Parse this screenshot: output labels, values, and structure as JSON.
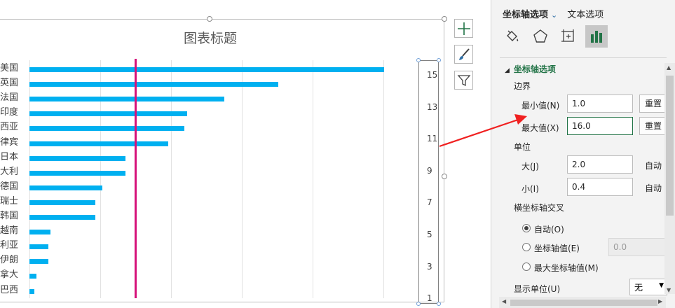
{
  "chart": {
    "title": "图表标题",
    "categories": [
      "美国",
      "英国",
      "法国",
      "印度",
      "西亚",
      "律宾",
      "日本",
      "大利",
      "德国",
      "瑞士",
      "韩国",
      "越南",
      "利亚",
      "伊朗",
      "拿大",
      "巴西"
    ],
    "values": [
      15.1,
      10.6,
      8.3,
      6.7,
      6.6,
      5.9,
      4.1,
      4.1,
      3.1,
      2.8,
      2.8,
      0.9,
      0.8,
      0.8,
      0.3,
      0.2
    ],
    "xmax": 16,
    "bar_color": "#00b0f0",
    "marker_color": "#d6127a",
    "secondary_ticks": [
      "15",
      "13",
      "11",
      "9",
      "7",
      "5",
      "3",
      "1"
    ]
  },
  "chart_data": {
    "type": "bar",
    "title": "图表标题",
    "categories": [
      "美国",
      "英国",
      "法国",
      "印度",
      "西亚",
      "律宾",
      "日本",
      "大利",
      "德国",
      "瑞士",
      "韩国",
      "越南",
      "利亚",
      "伊朗",
      "拿大",
      "巴西"
    ],
    "values": [
      15.1,
      10.6,
      8.3,
      6.7,
      6.6,
      5.9,
      4.1,
      4.1,
      3.1,
      2.8,
      2.8,
      0.9,
      0.8,
      0.8,
      0.3,
      0.2
    ],
    "secondary_axis_ticks": [
      15,
      13,
      11,
      9,
      7,
      5,
      3,
      1
    ],
    "secondary_axis_range": [
      1,
      16
    ],
    "grid": true
  },
  "panel": {
    "tab_axis": "坐标轴选项",
    "tab_text": "文本选项",
    "section": "坐标轴选项",
    "bounds": "边界",
    "min_label": "最小值(N)",
    "min_value": "1.0",
    "max_label": "最大值(X)",
    "max_value": "16.0",
    "reset": "重置",
    "units": "单位",
    "major_label": "大(J)",
    "major_value": "2.0",
    "minor_label": "小(I)",
    "minor_value": "0.4",
    "auto": "自动",
    "cross": "横坐标轴交叉",
    "radio_auto": "自动(O)",
    "radio_value": "坐标轴值(E)",
    "radio_value_input": "0.0",
    "radio_max": "最大坐标轴值(M)",
    "display_units": "显示单位(U)",
    "display_units_value": "无"
  }
}
